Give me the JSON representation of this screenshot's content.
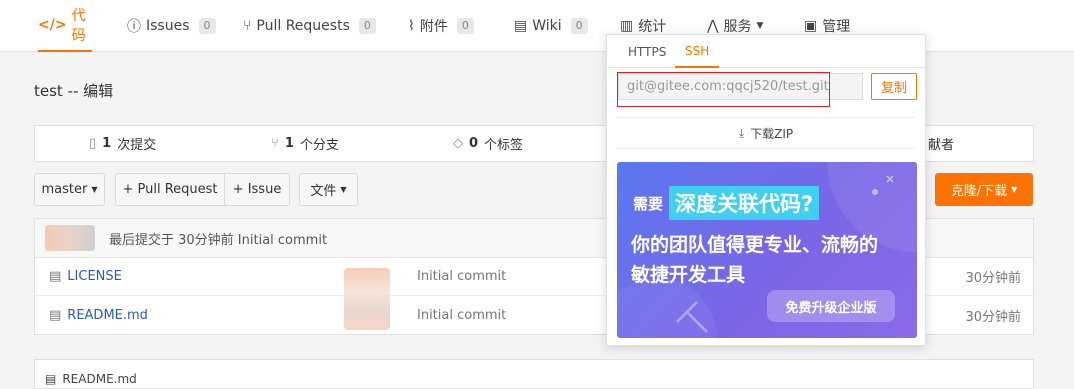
{
  "nav": {
    "tabs": [
      {
        "label": "代码",
        "icon": "code-icon"
      },
      {
        "label": "Issues",
        "count": "0",
        "icon": "issue-icon"
      },
      {
        "label": "Pull Requests",
        "count": "0",
        "icon": "pull-request-icon"
      },
      {
        "label": "附件",
        "count": "0",
        "icon": "attachment-icon"
      },
      {
        "label": "Wiki",
        "count": "0",
        "icon": "wiki-icon"
      },
      {
        "label": "统计",
        "icon": "stats-icon"
      },
      {
        "label": "服务",
        "icon": "service-icon"
      },
      {
        "label": "管理",
        "icon": "manage-icon"
      }
    ]
  },
  "repo": {
    "title": "test -- 编辑"
  },
  "stats": {
    "commits": {
      "num": "1",
      "label": "次提交"
    },
    "branches": {
      "num": "1",
      "label": "个分支"
    },
    "tags": {
      "num": "0",
      "label": "个标签"
    },
    "contributors_partial": "献者"
  },
  "toolbar": {
    "branch": "master",
    "pull_request": "+ Pull Request",
    "issue": "+ Issue",
    "file": "文件",
    "clone": "克隆/下载"
  },
  "files": {
    "latest_commit": "最后提交于 30分钟前 Initial commit",
    "rows": [
      {
        "name": "LICENSE",
        "msg": "Initial commit",
        "time": "30分钟前"
      },
      {
        "name": "README.md",
        "msg": "Initial commit",
        "time": "30分钟前"
      }
    ]
  },
  "readme_partial": "README.md",
  "clone_dropdown": {
    "tabs": [
      "HTTPS",
      "SSH"
    ],
    "active_tab": "SSH",
    "url": "git@gitee.com:qqcj520/test.git",
    "copy": "复制",
    "download_zip": "下载ZIP"
  },
  "ad": {
    "prefix": "需要",
    "highlight": "深度关联代码?",
    "line2": "你的团队值得更专业、流畅的",
    "line3": "敏捷开发工具",
    "cta": "免费升级企业版"
  },
  "colors": {
    "accent": "#fe7300",
    "highlight_box": "#e02020",
    "link": "#2a5db0"
  }
}
